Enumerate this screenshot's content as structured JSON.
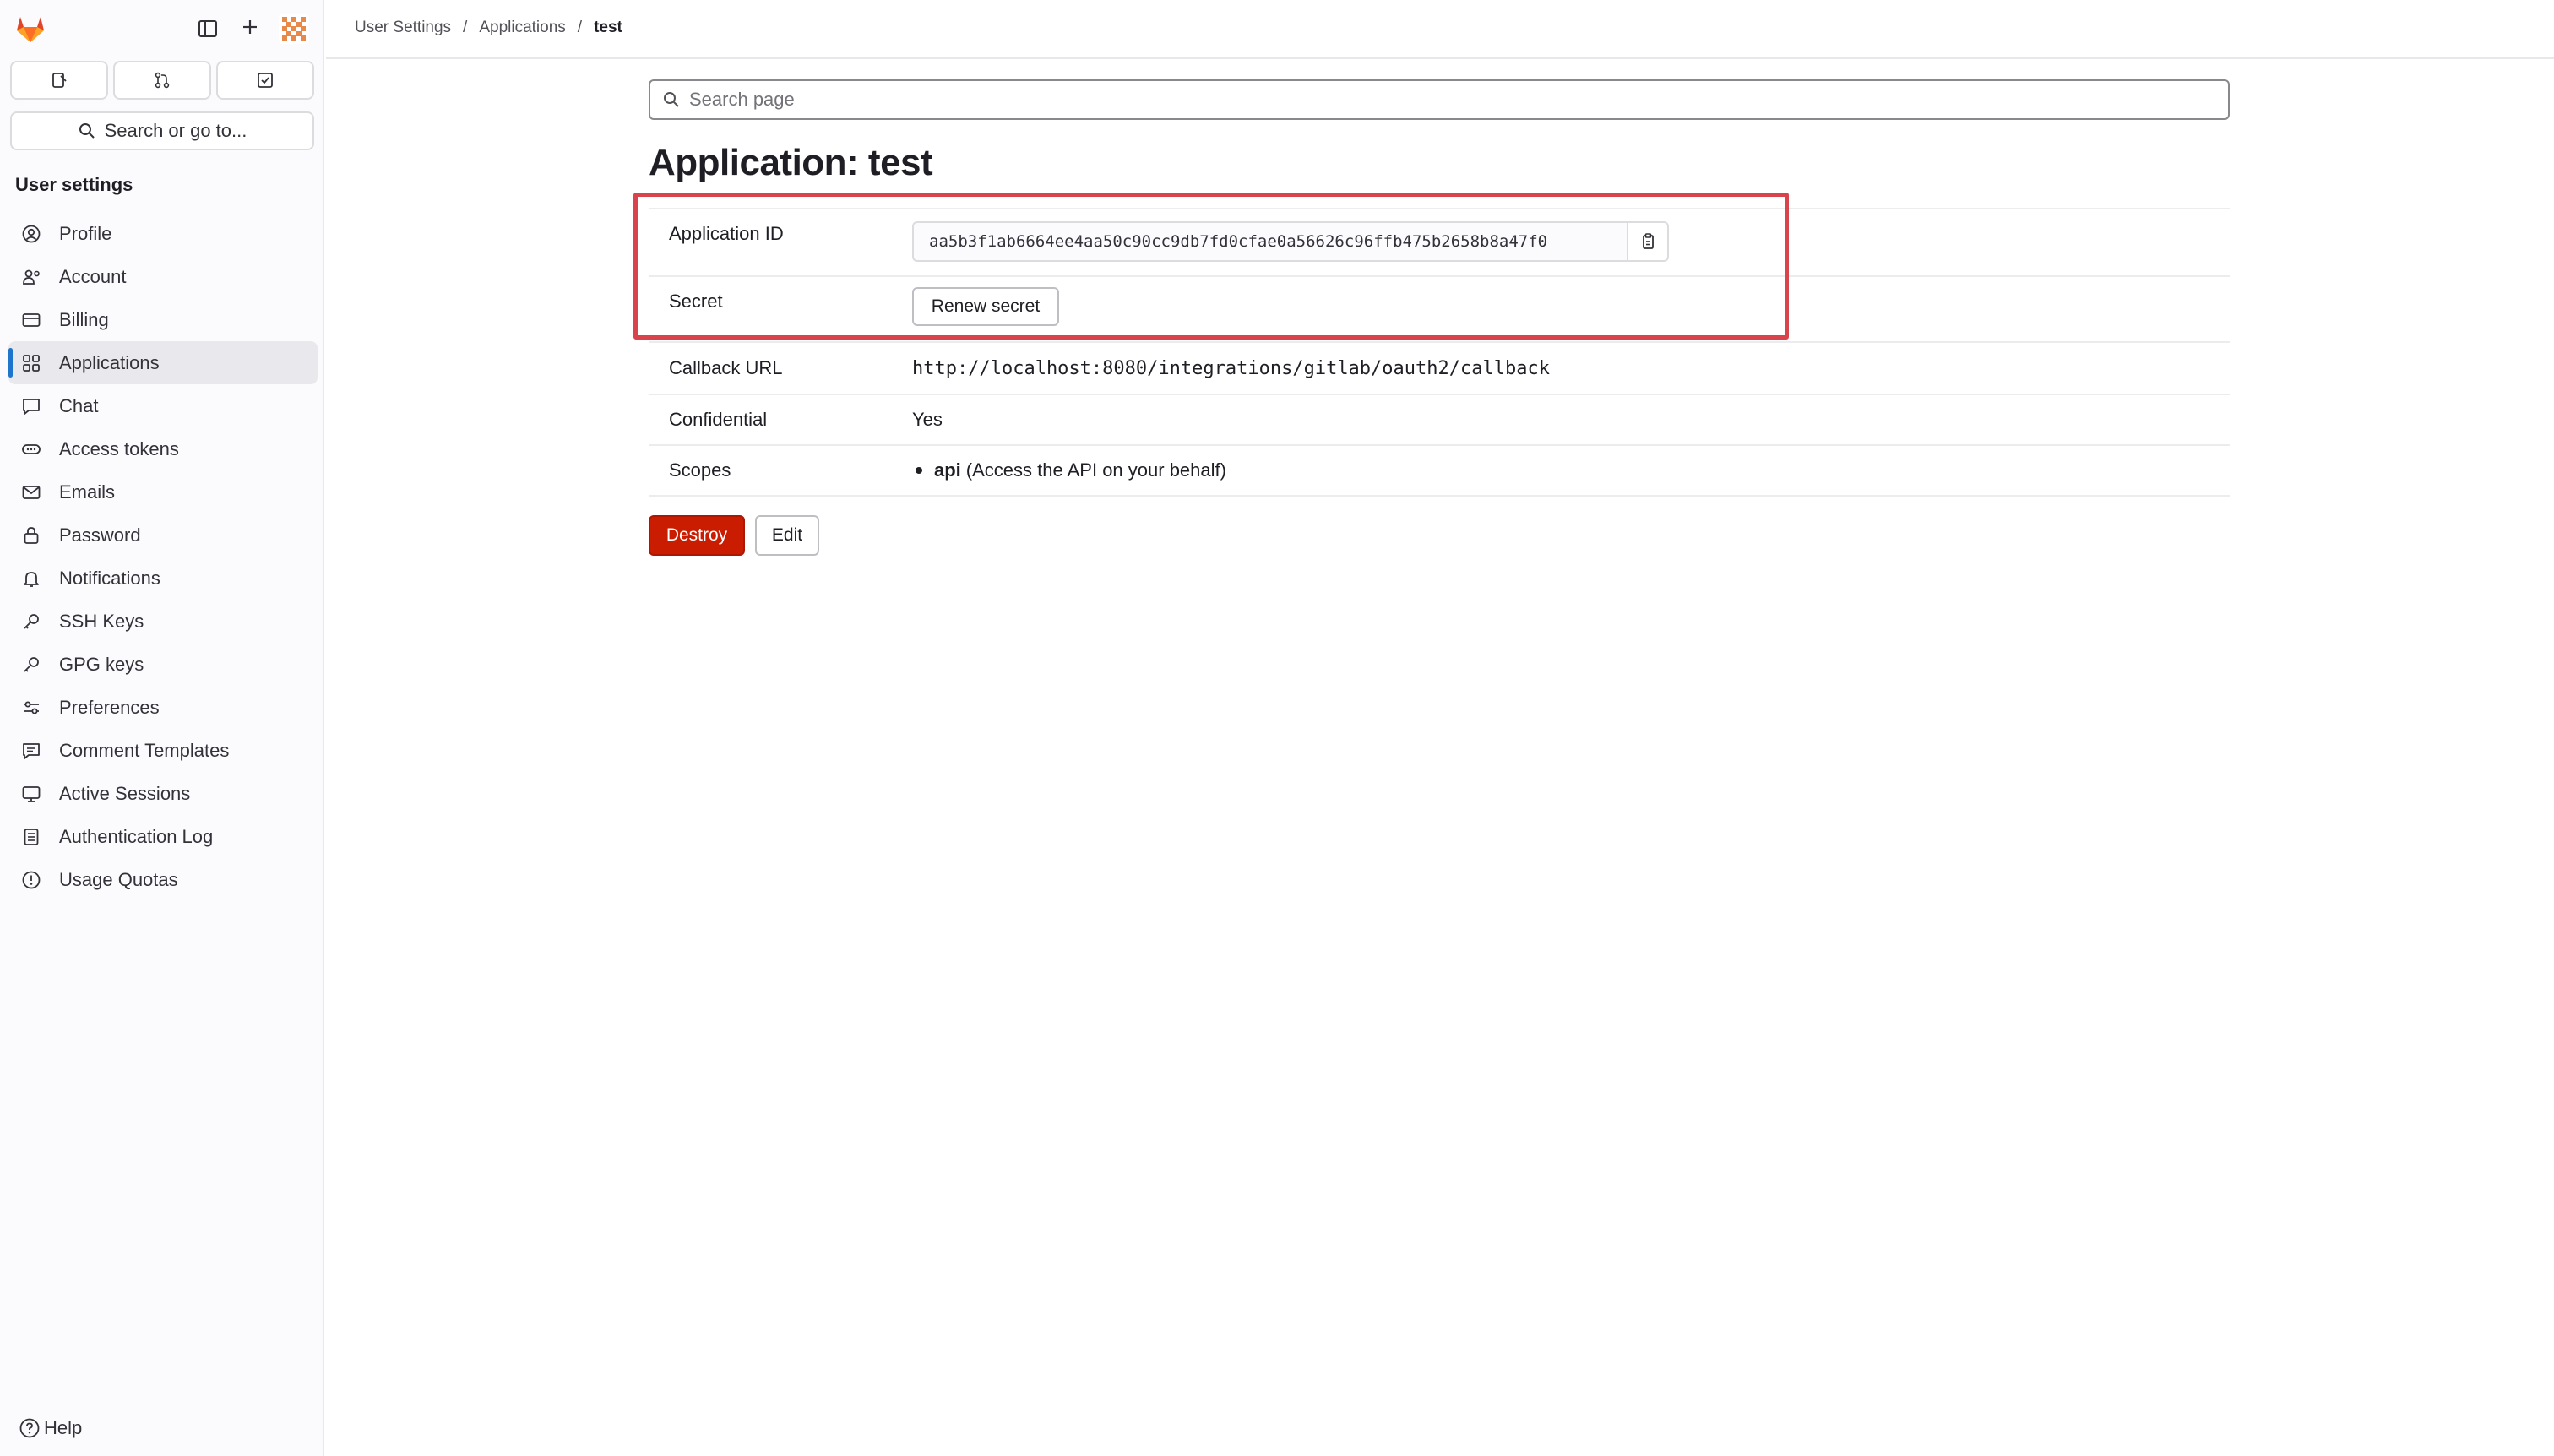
{
  "sidebar": {
    "search_label": "Search or go to...",
    "heading": "User settings",
    "items": [
      {
        "label": "Profile",
        "icon": "profile-icon"
      },
      {
        "label": "Account",
        "icon": "account-icon"
      },
      {
        "label": "Billing",
        "icon": "billing-icon"
      },
      {
        "label": "Applications",
        "icon": "applications-icon"
      },
      {
        "label": "Chat",
        "icon": "chat-icon"
      },
      {
        "label": "Access tokens",
        "icon": "token-icon"
      },
      {
        "label": "Emails",
        "icon": "mail-icon"
      },
      {
        "label": "Password",
        "icon": "lock-icon"
      },
      {
        "label": "Notifications",
        "icon": "bell-icon"
      },
      {
        "label": "SSH Keys",
        "icon": "key-icon"
      },
      {
        "label": "GPG keys",
        "icon": "key-icon"
      },
      {
        "label": "Preferences",
        "icon": "preferences-icon"
      },
      {
        "label": "Comment Templates",
        "icon": "comment-icon"
      },
      {
        "label": "Active Sessions",
        "icon": "monitor-icon"
      },
      {
        "label": "Authentication Log",
        "icon": "log-icon"
      },
      {
        "label": "Usage Quotas",
        "icon": "quota-icon"
      }
    ],
    "active_item": "Applications",
    "help_label": "Help"
  },
  "breadcrumb": {
    "items": [
      "User Settings",
      "Applications",
      "test"
    ],
    "separator": "/"
  },
  "search": {
    "placeholder": "Search page"
  },
  "page": {
    "title": "Application: test"
  },
  "details": {
    "app_id_label": "Application ID",
    "app_id_value": "aa5b3f1ab6664ee4aa50c90cc9db7fd0cfae0a56626c96ffb475b2658b8a47f0",
    "secret_label": "Secret",
    "renew_secret_label": "Renew secret",
    "callback_label": "Callback URL",
    "callback_value": "http://localhost:8080/integrations/gitlab/oauth2/callback",
    "confidential_label": "Confidential",
    "confidential_value": "Yes",
    "scopes_label": "Scopes",
    "scope_name": "api",
    "scope_desc": "(Access the API on your behalf)"
  },
  "actions": {
    "destroy_label": "Destroy",
    "edit_label": "Edit"
  },
  "colors": {
    "accent": "#1f75cb",
    "danger": "#c91c00",
    "highlight": "#d9434b",
    "brand": "#e24329"
  }
}
